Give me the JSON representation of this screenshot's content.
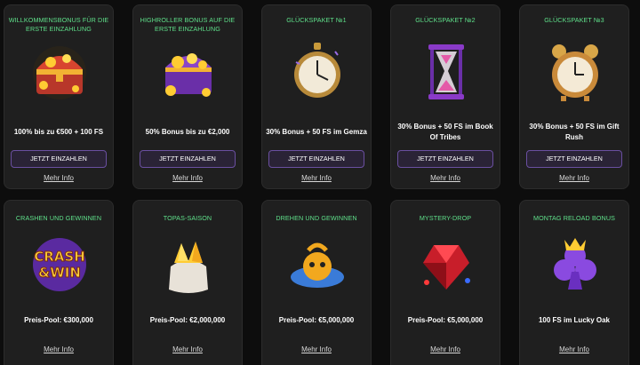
{
  "colors": {
    "background": "#0d0d0d",
    "card": "#1f1f1f",
    "title_accent": "#5fe08a",
    "button_border": "#6a4fa0",
    "button_fill": "#2a2336"
  },
  "bonuses": [
    {
      "title": "WILLKOMMENSBONUS FÜR DIE ERSTE EINZAHLUNG",
      "icon": "treasure-chest-icon",
      "description": "100% bis zu €500 + 100 FS",
      "button": "JETZT EINZAHLEN",
      "more": "Mehr Info"
    },
    {
      "title": "HIGHROLLER BONUS AUF DIE ERSTE EINZAHLUNG",
      "icon": "gold-chest-icon",
      "description": "50% Bonus bis zu €2,000",
      "button": "JETZT EINZAHLEN",
      "more": "Mehr Info"
    },
    {
      "title": "GLÜCKSPAKET №1",
      "icon": "stopwatch-icon",
      "description": "30% Bonus + 50 FS im Gemza",
      "button": "JETZT EINZAHLEN",
      "more": "Mehr Info"
    },
    {
      "title": "GLÜCKSPAKET №2",
      "icon": "hourglass-icon",
      "description": "30% Bonus + 50 FS im Book Of Tribes",
      "button": "JETZT EINZAHLEN",
      "more": "Mehr Info"
    },
    {
      "title": "GLÜCKSPAKET №3",
      "icon": "alarm-clock-icon",
      "description": "30% Bonus + 50 FS im Gift Rush",
      "button": "JETZT EINZAHLEN",
      "more": "Mehr Info"
    }
  ],
  "promotions": [
    {
      "title": "CRASHEN UND GEWINNEN",
      "icon": "crash-win-logo-icon",
      "logo_text": [
        "CRASH",
        "&WIN"
      ],
      "description": "Preis-Pool: €300,000",
      "more": "Mehr Info"
    },
    {
      "title": "TOPAS-SAISON",
      "icon": "gem-bag-icon",
      "description": "Preis-Pool: €2,000,000",
      "more": "Mehr Info"
    },
    {
      "title": "DREHEN UND GEWINNEN",
      "icon": "spinning-character-icon",
      "description": "Preis-Pool: €5,000,000",
      "more": "Mehr Info"
    },
    {
      "title": "MYSTERY-DROP",
      "icon": "red-gem-icon",
      "description": "Preis-Pool: €5,000,000",
      "more": "Mehr Info"
    },
    {
      "title": "MONTAG RELOAD BONUS",
      "icon": "club-crown-icon",
      "description": "100 FS im Lucky Oak",
      "more": "Mehr Info"
    }
  ]
}
